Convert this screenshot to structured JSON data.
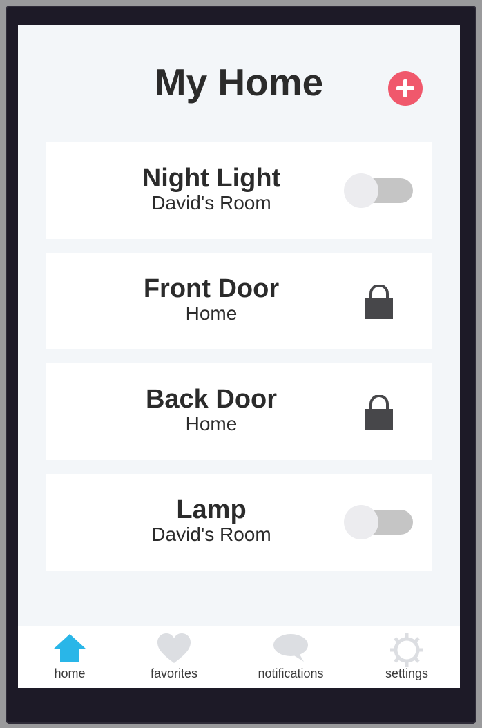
{
  "header": {
    "title": "My Home",
    "add_icon": "plus-circle-icon"
  },
  "devices": [
    {
      "name": "Night Light",
      "location": "David's Room",
      "control": "toggle",
      "on": false
    },
    {
      "name": "Front Door",
      "location": "Home",
      "control": "lock",
      "locked": true
    },
    {
      "name": "Back Door",
      "location": "Home",
      "control": "lock",
      "locked": true
    },
    {
      "name": "Lamp",
      "location": "David's Room",
      "control": "toggle",
      "on": false
    }
  ],
  "tabs": [
    {
      "label": "home",
      "icon": "home-icon",
      "active": true
    },
    {
      "label": "favorites",
      "icon": "heart-icon",
      "active": false
    },
    {
      "label": "notifications",
      "icon": "speech-bubble-icon",
      "active": false
    },
    {
      "label": "settings",
      "icon": "gear-icon",
      "active": false
    }
  ],
  "colors": {
    "accent_add": "#f0586c",
    "active_tab": "#29b6e8",
    "inactive_tab_icon": "#dcdee2",
    "lock": "#47474a",
    "toggle_track": "#c5c5c5",
    "toggle_knob": "#ececef"
  }
}
